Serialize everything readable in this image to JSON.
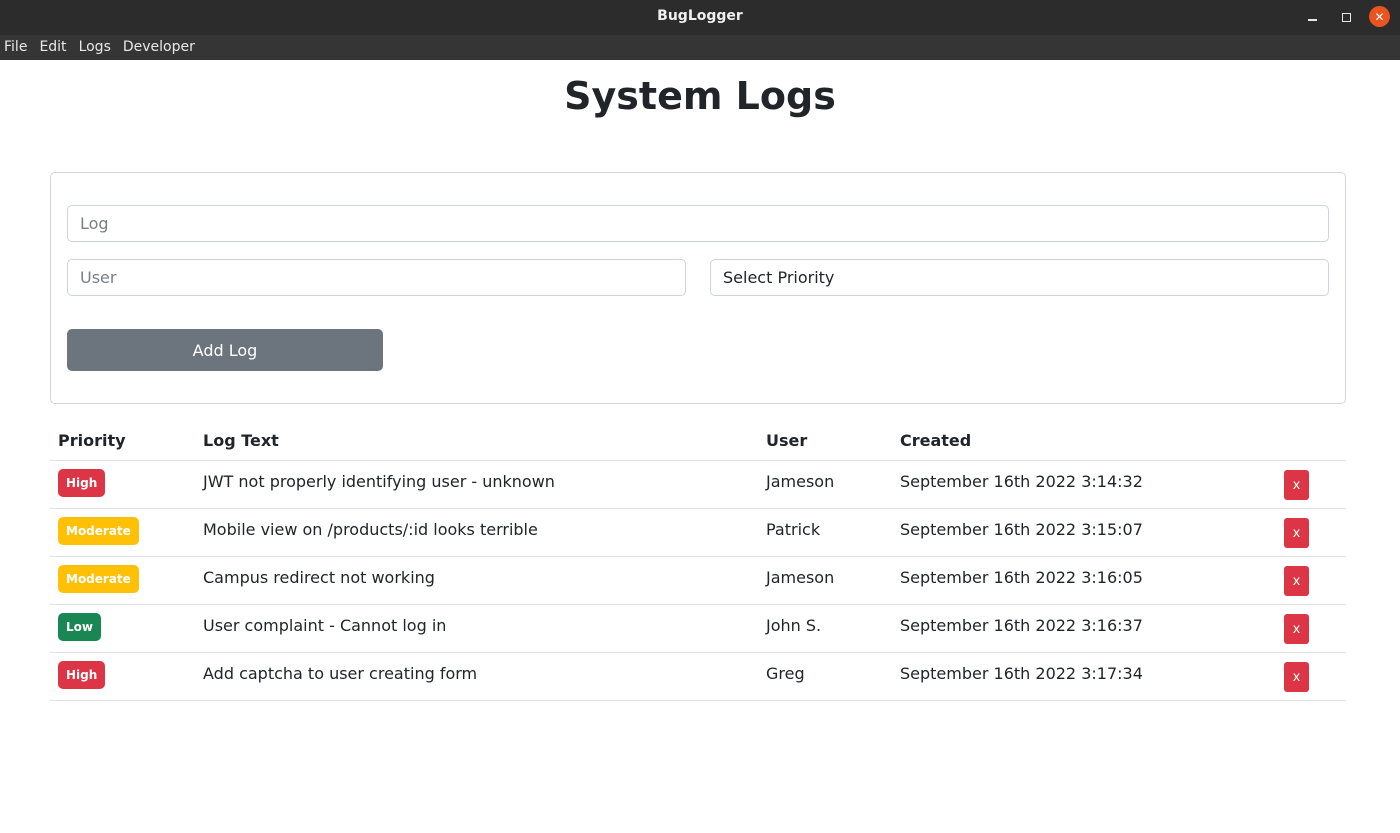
{
  "window": {
    "title": "BugLogger"
  },
  "menu": [
    "File",
    "Edit",
    "Logs",
    "Developer"
  ],
  "page": {
    "title": "System Logs"
  },
  "form": {
    "log_placeholder": "Log",
    "user_placeholder": "User",
    "priority_selected": "Select Priority",
    "add_label": "Add Log"
  },
  "table": {
    "headers": [
      "Priority",
      "Log Text",
      "User",
      "Created"
    ],
    "delete_label": "x",
    "rows": [
      {
        "priority": "High",
        "color": "#dc3545",
        "text_color": "#ffffff",
        "text": "JWT not properly identifying user - unknown",
        "user": "Jameson",
        "created": "September 16th 2022 3:14:32"
      },
      {
        "priority": "Moderate",
        "color": "#ffc107",
        "text_color": "#ffffff",
        "text": "Mobile view on /products/:id looks terrible",
        "user": "Patrick",
        "created": "September 16th 2022 3:15:07"
      },
      {
        "priority": "Moderate",
        "color": "#ffc107",
        "text_color": "#ffffff",
        "text": "Campus redirect not working",
        "user": "Jameson",
        "created": "September 16th 2022 3:16:05"
      },
      {
        "priority": "Low",
        "color": "#198754",
        "text_color": "#ffffff",
        "text": "User complaint - Cannot log in",
        "user": "John S.",
        "created": "September 16th 2022 3:16:37"
      },
      {
        "priority": "High",
        "color": "#dc3545",
        "text_color": "#ffffff",
        "text": "Add captcha to user creating form",
        "user": "Greg",
        "created": "September 16th 2022 3:17:34"
      }
    ]
  },
  "colors": {
    "add_button": "#6c757d",
    "delete_button": "#dc3545",
    "close_button": "#e95420"
  }
}
